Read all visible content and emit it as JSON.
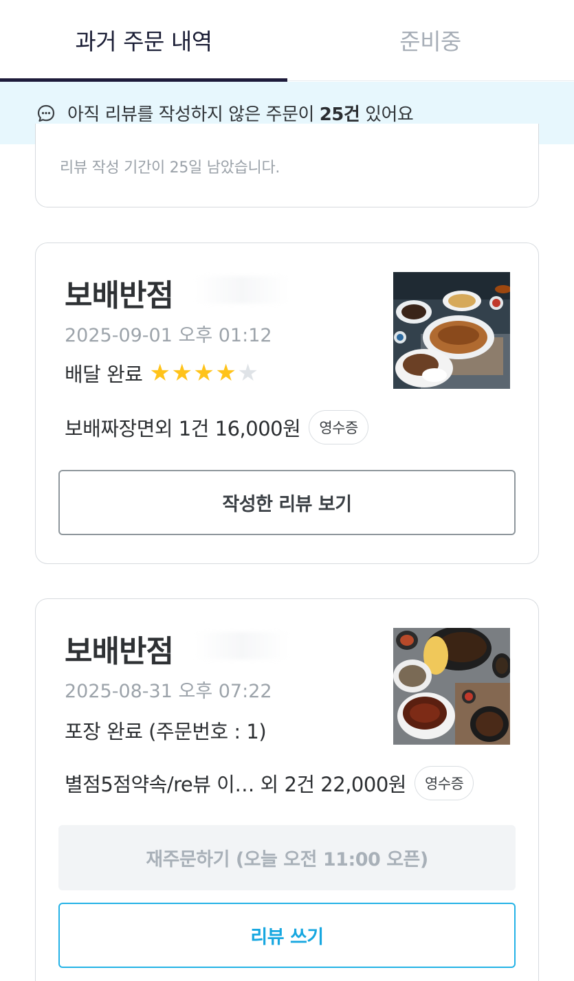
{
  "tabs": [
    {
      "label": "과거 주문 내역",
      "active": true
    },
    {
      "label": "준비중",
      "active": false
    }
  ],
  "banner": {
    "text_prefix": "아직 리뷰를 작성하지 않은 주문이 ",
    "count": "25건",
    "text_suffix": " 있어요",
    "icon": "chat-bubble-icon"
  },
  "top_card": {
    "note": "리뷰 작성 기간이 25일 남았습니다."
  },
  "orders": [
    {
      "store": "보배반점",
      "date": "2025-09-01 오후 01:12",
      "status": "배달 완료",
      "rating": 4,
      "rating_max": 5,
      "summary": "보배짜장면외 1건 16,000원",
      "receipt_label": "영수증",
      "primary_button": "작성한 리뷰 보기"
    },
    {
      "store": "보배반점",
      "date": "2025-08-31 오후 07:22",
      "status": "포장 완료 (주문번호 : 1)",
      "summary": "별점5점약속/re뷰 이… 외 2건 22,000원",
      "receipt_label": "영수증",
      "reorder_button": "재주문하기 (오늘 오전 11:00 오픈)",
      "review_button": "리뷰 쓰기"
    }
  ],
  "colors": {
    "accent_blue": "#17a7e0",
    "star": "#ffc31a",
    "banner_bg": "#e7f7fd",
    "tab_indicator": "#1d1b3a"
  }
}
